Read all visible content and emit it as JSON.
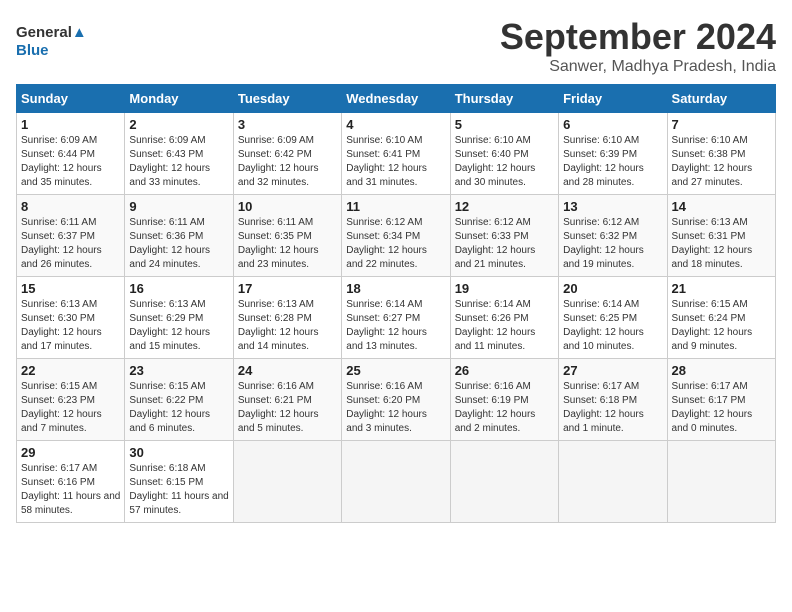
{
  "header": {
    "logo_line1": "General",
    "logo_line2": "Blue",
    "month_title": "September 2024",
    "location": "Sanwer, Madhya Pradesh, India"
  },
  "weekdays": [
    "Sunday",
    "Monday",
    "Tuesday",
    "Wednesday",
    "Thursday",
    "Friday",
    "Saturday"
  ],
  "weeks": [
    [
      {
        "day": "1",
        "sunrise": "6:09 AM",
        "sunset": "6:44 PM",
        "daylight": "12 hours and 35 minutes."
      },
      {
        "day": "2",
        "sunrise": "6:09 AM",
        "sunset": "6:43 PM",
        "daylight": "12 hours and 33 minutes."
      },
      {
        "day": "3",
        "sunrise": "6:09 AM",
        "sunset": "6:42 PM",
        "daylight": "12 hours and 32 minutes."
      },
      {
        "day": "4",
        "sunrise": "6:10 AM",
        "sunset": "6:41 PM",
        "daylight": "12 hours and 31 minutes."
      },
      {
        "day": "5",
        "sunrise": "6:10 AM",
        "sunset": "6:40 PM",
        "daylight": "12 hours and 30 minutes."
      },
      {
        "day": "6",
        "sunrise": "6:10 AM",
        "sunset": "6:39 PM",
        "daylight": "12 hours and 28 minutes."
      },
      {
        "day": "7",
        "sunrise": "6:10 AM",
        "sunset": "6:38 PM",
        "daylight": "12 hours and 27 minutes."
      }
    ],
    [
      {
        "day": "8",
        "sunrise": "6:11 AM",
        "sunset": "6:37 PM",
        "daylight": "12 hours and 26 minutes."
      },
      {
        "day": "9",
        "sunrise": "6:11 AM",
        "sunset": "6:36 PM",
        "daylight": "12 hours and 24 minutes."
      },
      {
        "day": "10",
        "sunrise": "6:11 AM",
        "sunset": "6:35 PM",
        "daylight": "12 hours and 23 minutes."
      },
      {
        "day": "11",
        "sunrise": "6:12 AM",
        "sunset": "6:34 PM",
        "daylight": "12 hours and 22 minutes."
      },
      {
        "day": "12",
        "sunrise": "6:12 AM",
        "sunset": "6:33 PM",
        "daylight": "12 hours and 21 minutes."
      },
      {
        "day": "13",
        "sunrise": "6:12 AM",
        "sunset": "6:32 PM",
        "daylight": "12 hours and 19 minutes."
      },
      {
        "day": "14",
        "sunrise": "6:13 AM",
        "sunset": "6:31 PM",
        "daylight": "12 hours and 18 minutes."
      }
    ],
    [
      {
        "day": "15",
        "sunrise": "6:13 AM",
        "sunset": "6:30 PM",
        "daylight": "12 hours and 17 minutes."
      },
      {
        "day": "16",
        "sunrise": "6:13 AM",
        "sunset": "6:29 PM",
        "daylight": "12 hours and 15 minutes."
      },
      {
        "day": "17",
        "sunrise": "6:13 AM",
        "sunset": "6:28 PM",
        "daylight": "12 hours and 14 minutes."
      },
      {
        "day": "18",
        "sunrise": "6:14 AM",
        "sunset": "6:27 PM",
        "daylight": "12 hours and 13 minutes."
      },
      {
        "day": "19",
        "sunrise": "6:14 AM",
        "sunset": "6:26 PM",
        "daylight": "12 hours and 11 minutes."
      },
      {
        "day": "20",
        "sunrise": "6:14 AM",
        "sunset": "6:25 PM",
        "daylight": "12 hours and 10 minutes."
      },
      {
        "day": "21",
        "sunrise": "6:15 AM",
        "sunset": "6:24 PM",
        "daylight": "12 hours and 9 minutes."
      }
    ],
    [
      {
        "day": "22",
        "sunrise": "6:15 AM",
        "sunset": "6:23 PM",
        "daylight": "12 hours and 7 minutes."
      },
      {
        "day": "23",
        "sunrise": "6:15 AM",
        "sunset": "6:22 PM",
        "daylight": "12 hours and 6 minutes."
      },
      {
        "day": "24",
        "sunrise": "6:16 AM",
        "sunset": "6:21 PM",
        "daylight": "12 hours and 5 minutes."
      },
      {
        "day": "25",
        "sunrise": "6:16 AM",
        "sunset": "6:20 PM",
        "daylight": "12 hours and 3 minutes."
      },
      {
        "day": "26",
        "sunrise": "6:16 AM",
        "sunset": "6:19 PM",
        "daylight": "12 hours and 2 minutes."
      },
      {
        "day": "27",
        "sunrise": "6:17 AM",
        "sunset": "6:18 PM",
        "daylight": "12 hours and 1 minute."
      },
      {
        "day": "28",
        "sunrise": "6:17 AM",
        "sunset": "6:17 PM",
        "daylight": "12 hours and 0 minutes."
      }
    ],
    [
      {
        "day": "29",
        "sunrise": "6:17 AM",
        "sunset": "6:16 PM",
        "daylight": "11 hours and 58 minutes."
      },
      {
        "day": "30",
        "sunrise": "6:18 AM",
        "sunset": "6:15 PM",
        "daylight": "11 hours and 57 minutes."
      },
      {
        "day": "",
        "sunrise": "",
        "sunset": "",
        "daylight": ""
      },
      {
        "day": "",
        "sunrise": "",
        "sunset": "",
        "daylight": ""
      },
      {
        "day": "",
        "sunrise": "",
        "sunset": "",
        "daylight": ""
      },
      {
        "day": "",
        "sunrise": "",
        "sunset": "",
        "daylight": ""
      },
      {
        "day": "",
        "sunrise": "",
        "sunset": "",
        "daylight": ""
      }
    ]
  ]
}
